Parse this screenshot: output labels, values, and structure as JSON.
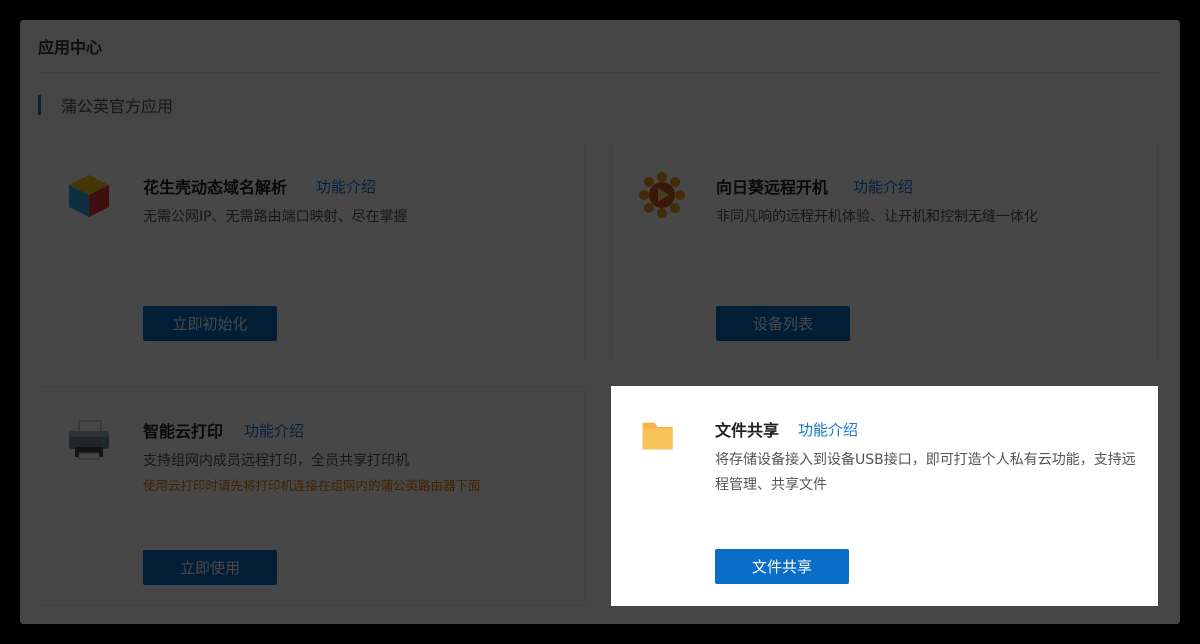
{
  "page": {
    "title": "应用中心",
    "section_title": "蒲公英官方应用"
  },
  "apps": [
    {
      "name": "花生壳动态域名解析",
      "intro_link": "功能介绍",
      "description": "无需公网IP、无需路由端口映射、尽在掌握",
      "button": "立即初始化",
      "icon": "peanut-shell-cube-icon"
    },
    {
      "name": "向日葵远程开机",
      "intro_link": "功能介绍",
      "description": "非同凡响的远程开机体验、让开机和控制无缝一体化",
      "button": "设备列表",
      "icon": "sunflower-icon"
    },
    {
      "name": "智能云打印",
      "intro_link": "功能介绍",
      "description": "支持组网内成员远程打印，全员共享打印机",
      "warning": "使用云打印时请先将打印机连接在组网内的蒲公英路由器下面",
      "button": "立即使用",
      "icon": "printer-icon"
    },
    {
      "name": "文件共享",
      "intro_link": "功能介绍",
      "description": "将存储设备接入到设备USB接口，即可打造个人私有云功能，支持远程管理、共享文件",
      "button": "文件共享",
      "icon": "folder-icon"
    }
  ],
  "colors": {
    "accent": "#1677d2",
    "button": "#0a6ec7",
    "warning": "#e67e00",
    "overlay": "rgba(0,0,0,0.72)"
  }
}
